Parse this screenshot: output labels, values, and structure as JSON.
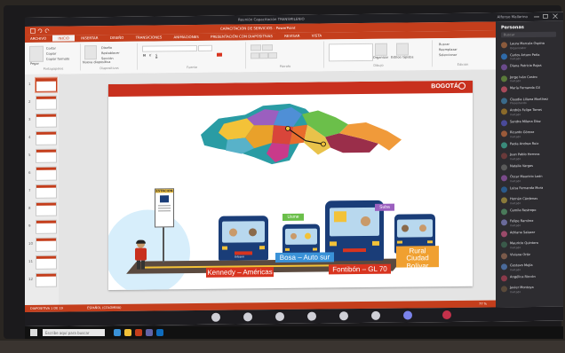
{
  "meeting": {
    "title": "Reunión Capacitación TRANSMILENIO",
    "user": "Alfonso Mallarino"
  },
  "ppt": {
    "doc_title": "CAPACITACION DE SERVICIOS - PowerPoint",
    "tabs": [
      "ARCHIVO",
      "INICIO",
      "INSERTAR",
      "DISEÑO",
      "TRANSICIONES",
      "ANIMACIONES",
      "PRESENTACIÓN CON DIAPOSITIVAS",
      "REVISAR",
      "VISTA"
    ],
    "active_tab": 1,
    "ribbon": {
      "clipboard": {
        "cut": "Cortar",
        "copy": "Copiar",
        "format_painter": "Copiar formato",
        "paste": "Pegar",
        "label": "Portapapeles"
      },
      "slides": {
        "new_slide": "Nueva diapositiva",
        "layout": "Diseño",
        "reset": "Restablecer",
        "section": "Sección",
        "label": "Diapositivas"
      },
      "font": {
        "label": "Fuente"
      },
      "paragraph": {
        "label": "Párrafo"
      },
      "drawing": {
        "arrange": "Organizar",
        "quick_styles": "Estilos rápidos",
        "label": "Dibujo"
      },
      "editing": {
        "find": "Buscar",
        "replace": "Reemplazar",
        "select": "Seleccionar",
        "label": "Edición"
      }
    },
    "slide_numbers": [
      "1",
      "2",
      "3",
      "4",
      "5",
      "6",
      "7",
      "8",
      "9",
      "10",
      "11",
      "12"
    ],
    "status": {
      "slide_of": "DIAPOSITIVA 1 DE 19",
      "language": "ESPAÑOL (COLOMBIA)",
      "zoom": "77 %"
    }
  },
  "slide": {
    "logo": "BOGOTÁ",
    "station_sign": "ESTACIÓN",
    "bus_brand": "Urbano",
    "labels": {
      "kennedy": "Kennedy – Américas",
      "bosa": "Bosa – Auto sur",
      "fontibon": "Fontibón – GL 70",
      "suba": "Suba",
      "usme": "Usme",
      "rural_line1": "Rural",
      "rural_line2": "Ciudad Bolívar"
    },
    "colors": {
      "red": "#d8341f",
      "blue": "#3a92d8",
      "orange": "#f0a030",
      "navy": "#1a3d78"
    }
  },
  "people": {
    "header": "Personas",
    "search_placeholder": "Buscar",
    "list": [
      {
        "name": "Laura Marcela Ospina",
        "status": "Organizador",
        "color": "#8a5a3c"
      },
      {
        "name": "Carlos Arturo Peña",
        "status": "Invitado",
        "color": "#2f6aa8"
      },
      {
        "name": "Diana Patricia Rojas",
        "status": "",
        "color": "#6a4a8a"
      },
      {
        "name": "Jorge Iván Castro",
        "status": "Invitado",
        "color": "#5a7a3a"
      },
      {
        "name": "María Fernanda Gil",
        "status": "",
        "color": "#a84a5a"
      },
      {
        "name": "Claudia Liliana Martínez",
        "status": "Presentando",
        "color": "#3a6a8a"
      },
      {
        "name": "Andrés Felipe Torres",
        "status": "Invitado",
        "color": "#8a6a2a"
      },
      {
        "name": "Sandra Milena Díaz",
        "status": "",
        "color": "#4a4a9a"
      },
      {
        "name": "Ricardo Gómez",
        "status": "Invitado",
        "color": "#9a5a3a"
      },
      {
        "name": "Paola Andrea Ruiz",
        "status": "",
        "color": "#3a8a7a"
      },
      {
        "name": "Juan Pablo Herrera",
        "status": "Invitado",
        "color": "#6a3a3a"
      },
      {
        "name": "Natalia Vargas",
        "status": "",
        "color": "#5a5a5a"
      },
      {
        "name": "Óscar Mauricio León",
        "status": "Invitado",
        "color": "#7a4a8a"
      },
      {
        "name": "Luisa Fernanda Mora",
        "status": "",
        "color": "#2a5a8a"
      },
      {
        "name": "Hernán Cárdenas",
        "status": "Invitado",
        "color": "#8a7a3a"
      },
      {
        "name": "Camila Restrepo",
        "status": "",
        "color": "#4a7a5a"
      },
      {
        "name": "Felipe Ramírez",
        "status": "Invitado",
        "color": "#6a6a9a"
      },
      {
        "name": "Adriana Salazar",
        "status": "",
        "color": "#9a4a6a"
      },
      {
        "name": "Mauricio Quintero",
        "status": "Invitado",
        "color": "#3a5a4a"
      },
      {
        "name": "Viviana Ortiz",
        "status": "",
        "color": "#7a5a4a"
      },
      {
        "name": "Gustavo Mejía",
        "status": "Invitado",
        "color": "#4a6a9a"
      },
      {
        "name": "Angélica Rincón",
        "status": "",
        "color": "#8a3a4a"
      },
      {
        "name": "Javier Montoya",
        "status": "Invitado",
        "color": "#5a4a3a"
      }
    ]
  },
  "taskbar": {
    "search_placeholder": "Escribe aquí para buscar"
  }
}
